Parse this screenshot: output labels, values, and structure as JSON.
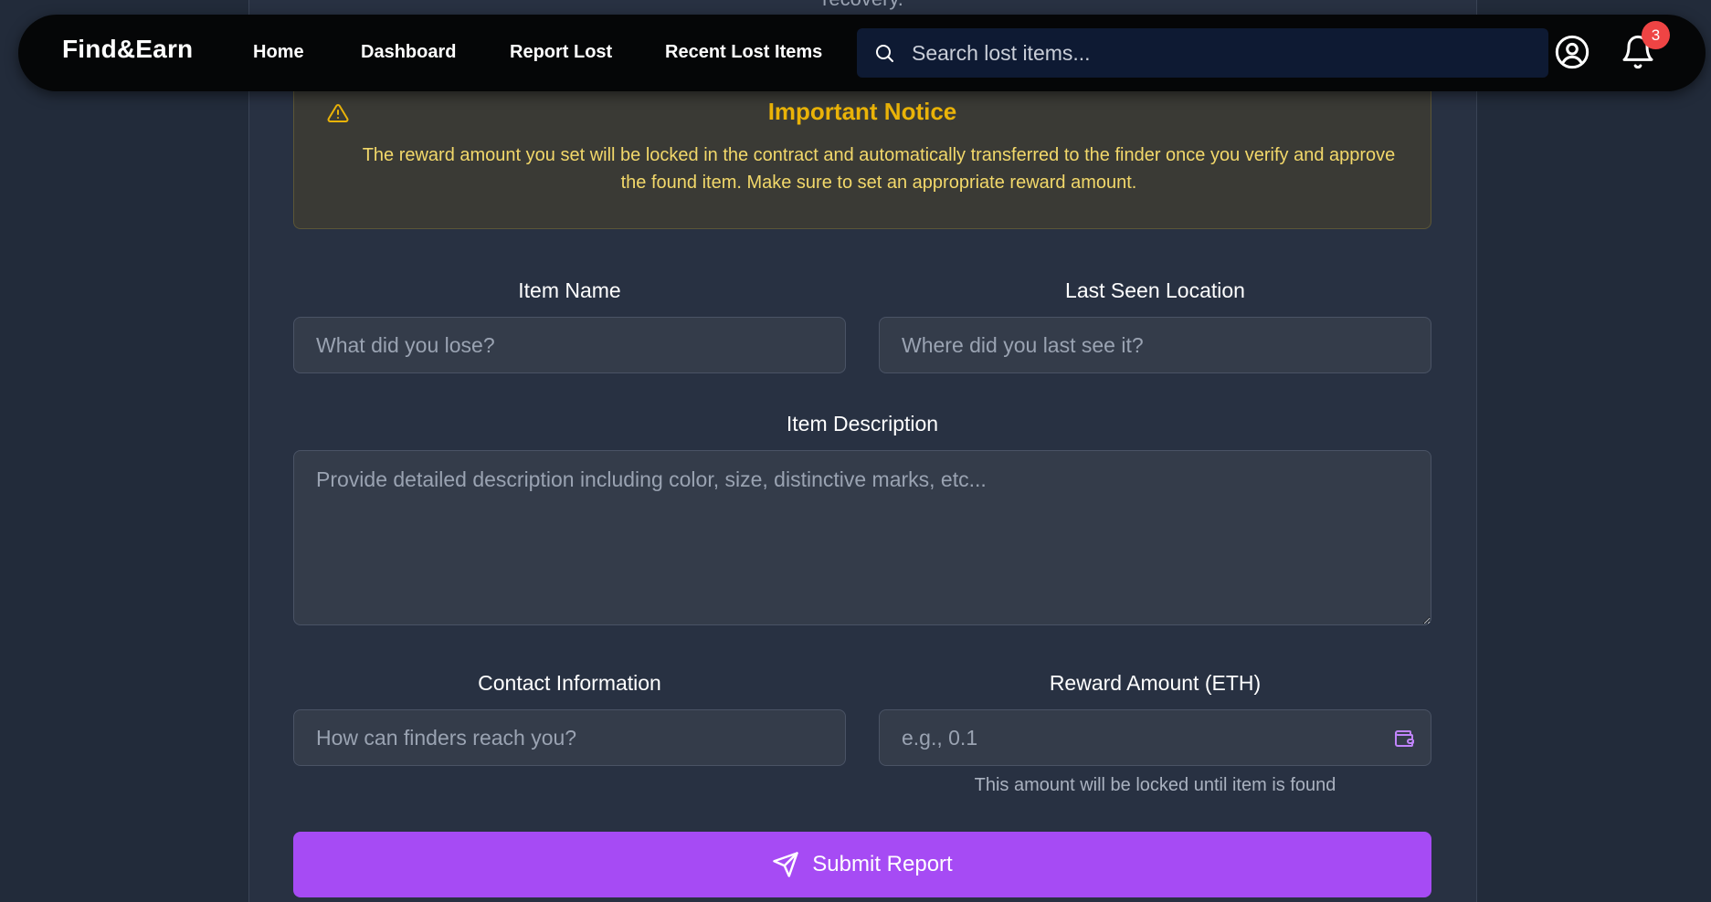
{
  "page": {
    "cut_text": "recovery."
  },
  "navbar": {
    "brand": "Find&Earn",
    "links": [
      "Home",
      "Dashboard",
      "Report Lost",
      "Recent Lost Items"
    ],
    "search_placeholder": "Search lost items...",
    "notification_count": "3"
  },
  "notice": {
    "title": "Important Notice",
    "text": "The reward amount you set will be locked in the contract and automatically transferred to the finder once you verify and approve the found item. Make sure to set an appropriate reward amount."
  },
  "form": {
    "item_name_label": "Item Name",
    "item_name_placeholder": "What did you lose?",
    "location_label": "Last Seen Location",
    "location_placeholder": "Where did you last see it?",
    "description_label": "Item Description",
    "description_placeholder": "Provide detailed description including color, size, distinctive marks, etc...",
    "contact_label": "Contact Information",
    "contact_placeholder": "How can finders reach you?",
    "reward_label": "Reward Amount (ETH)",
    "reward_placeholder": "e.g., 0.1",
    "reward_hint": "This amount will be locked until item is found",
    "submit_label": "Submit Report"
  },
  "icons": {
    "search": "search-icon",
    "profile": "user-circle-icon",
    "notifications": "bell-icon",
    "warning": "warning-triangle-icon",
    "wallet": "wallet-icon",
    "send": "send-icon"
  },
  "colors": {
    "accent": "#a64bf4",
    "warning": "#eab308",
    "badge": "#ef4444",
    "navbar": "#050607",
    "background": "#222b3a"
  }
}
